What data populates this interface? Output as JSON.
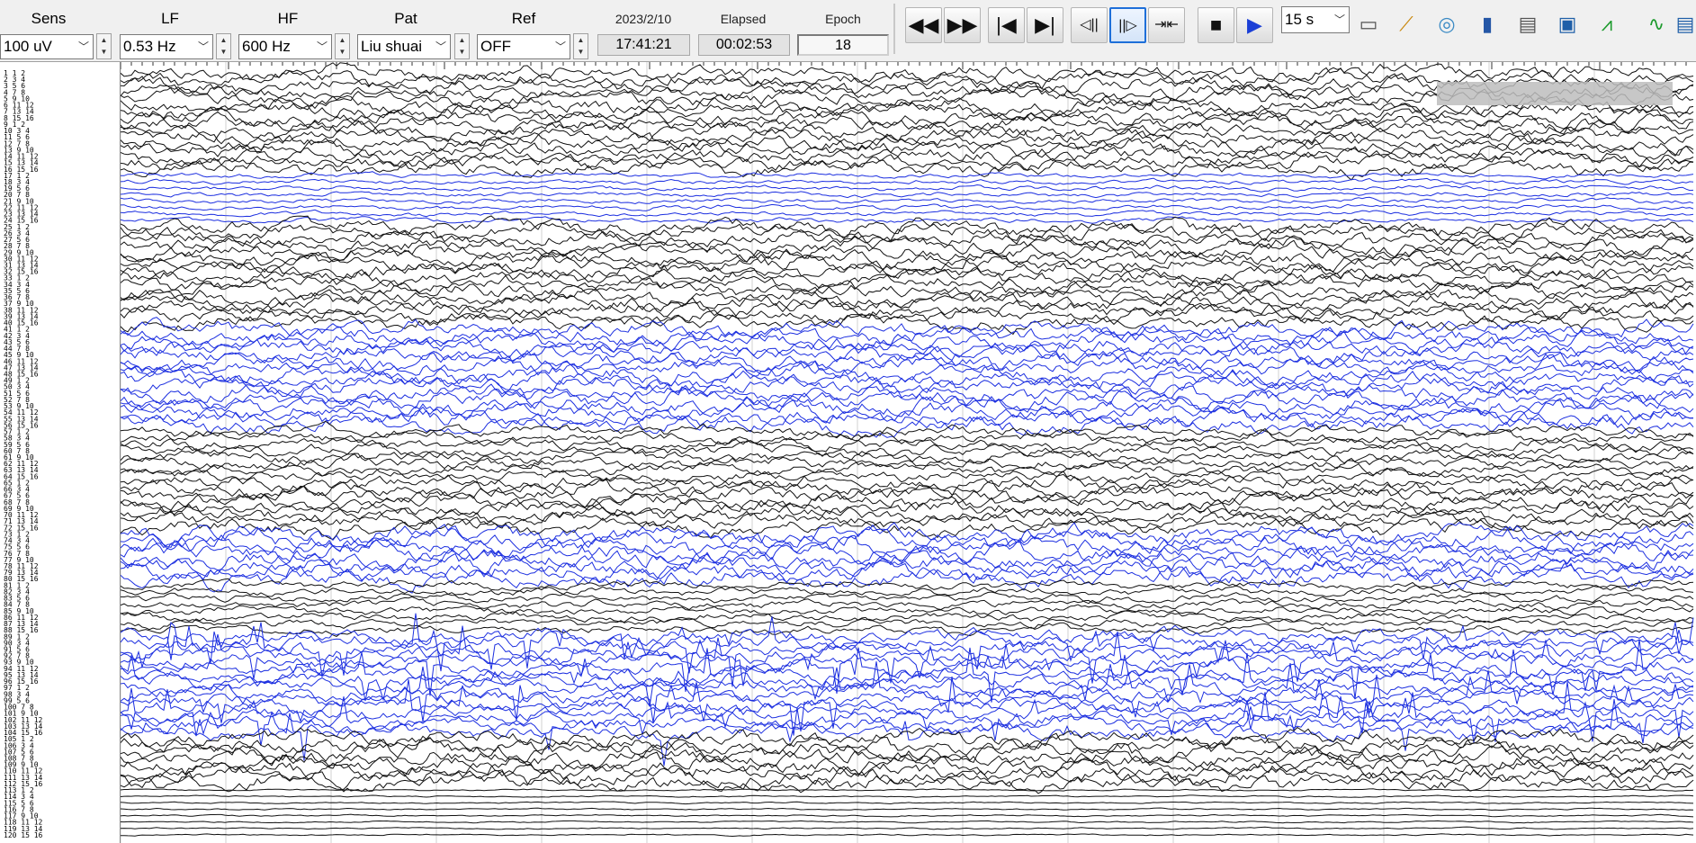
{
  "controls": {
    "sens": {
      "label": "Sens",
      "value": "100 uV"
    },
    "lf": {
      "label": "LF",
      "value": "0.53 Hz"
    },
    "hf": {
      "label": "HF",
      "value": "600 Hz"
    },
    "pat": {
      "label": "Pat",
      "value": "Liu shuai"
    },
    "ref": {
      "label": "Ref",
      "value": "OFF"
    }
  },
  "status": {
    "date": "2023/2/10",
    "time": "17:41:21",
    "elapsed_label": "Elapsed",
    "elapsed": "00:02:53",
    "epoch_label": "Epoch",
    "epoch": "18"
  },
  "toolbar": {
    "buttons": [
      {
        "name": "rewind-icon",
        "glyph": "◀◀"
      },
      {
        "name": "fast-forward-icon",
        "glyph": "▶▶"
      },
      {
        "name": "go-to-start-icon",
        "glyph": "|◀"
      },
      {
        "name": "go-to-end-icon",
        "glyph": "▶|"
      },
      {
        "name": "step-back-icon",
        "glyph": "◁||"
      },
      {
        "name": "step-forward-icon",
        "glyph": "||▷"
      },
      {
        "name": "split-marker-icon",
        "glyph": "⇥⇤"
      },
      {
        "name": "stop-icon",
        "glyph": "■"
      },
      {
        "name": "play-icon",
        "glyph": "▶"
      }
    ],
    "timebase": "15 s",
    "tools": [
      "save-icon",
      "chart-tool-icon",
      "montage-icon",
      "info-icon",
      "print-icon",
      "photo-icon",
      "spectrum-icon",
      "signal-icon",
      "export-icon"
    ]
  },
  "channels": {
    "count": 120,
    "label_rows": [
      "1  2",
      "3  4",
      "5  6",
      "7  8",
      "9  10",
      "11  12",
      "13  14",
      "15  16"
    ]
  },
  "trace_colors": {
    "black": "#111111",
    "blue": "#1c2fe0",
    "grid": "#d0d0d0"
  }
}
